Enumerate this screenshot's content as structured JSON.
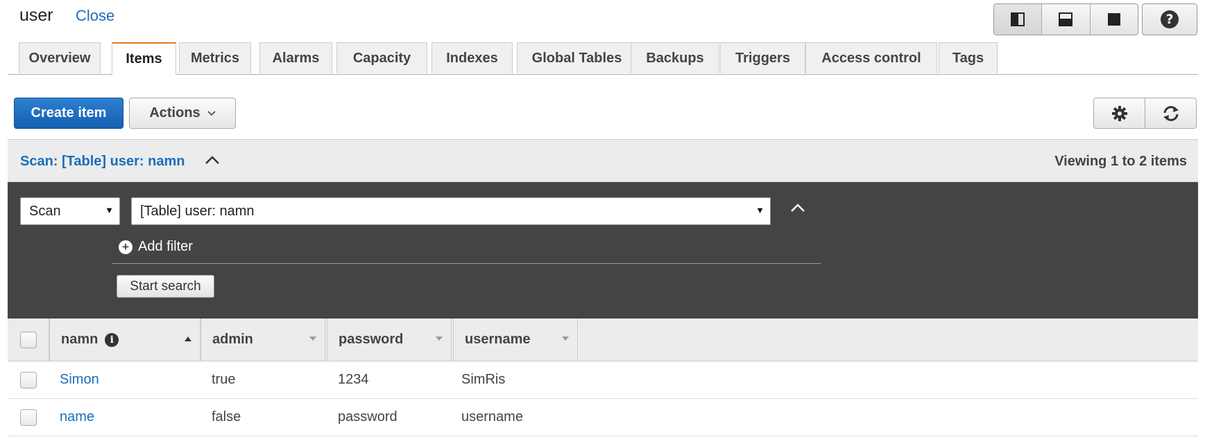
{
  "header": {
    "title": "user",
    "close_label": "Close",
    "view_modes": [
      "split-left-icon",
      "split-bottom-icon",
      "full-icon"
    ],
    "help_label": "?"
  },
  "tabs": [
    {
      "label": "Overview",
      "active": false
    },
    {
      "label": "Items",
      "active": true
    },
    {
      "label": "Metrics",
      "active": false
    },
    {
      "label": "Alarms",
      "active": false
    },
    {
      "label": "Capacity",
      "active": false
    },
    {
      "label": "Indexes",
      "active": false
    },
    {
      "label": "Global Tables",
      "active": false
    },
    {
      "label": "Backups",
      "active": false
    },
    {
      "label": "Triggers",
      "active": false
    },
    {
      "label": "Access control",
      "active": false
    },
    {
      "label": "Tags",
      "active": false
    }
  ],
  "toolbar": {
    "create_label": "Create item",
    "actions_label": "Actions"
  },
  "scan_bar": {
    "summary": "Scan: [Table] user: namn",
    "viewing": "Viewing 1 to 2 items"
  },
  "scan_panel": {
    "mode_value": "Scan",
    "table_value": "[Table] user: namn",
    "add_filter_label": "Add filter",
    "start_search_label": "Start search"
  },
  "table": {
    "columns": [
      {
        "label": "namn",
        "sort": "asc",
        "info": true
      },
      {
        "label": "admin",
        "sort": "none"
      },
      {
        "label": "password",
        "sort": "none"
      },
      {
        "label": "username",
        "sort": "none"
      }
    ],
    "rows": [
      [
        "Simon",
        "true",
        "1234",
        "SimRis"
      ],
      [
        "name",
        "false",
        "password",
        "username"
      ]
    ]
  },
  "colors": {
    "accent_tab": "#e07b17",
    "link": "#1a6ebd",
    "primary_button": "#1560b0",
    "panel_dark": "#444444"
  }
}
